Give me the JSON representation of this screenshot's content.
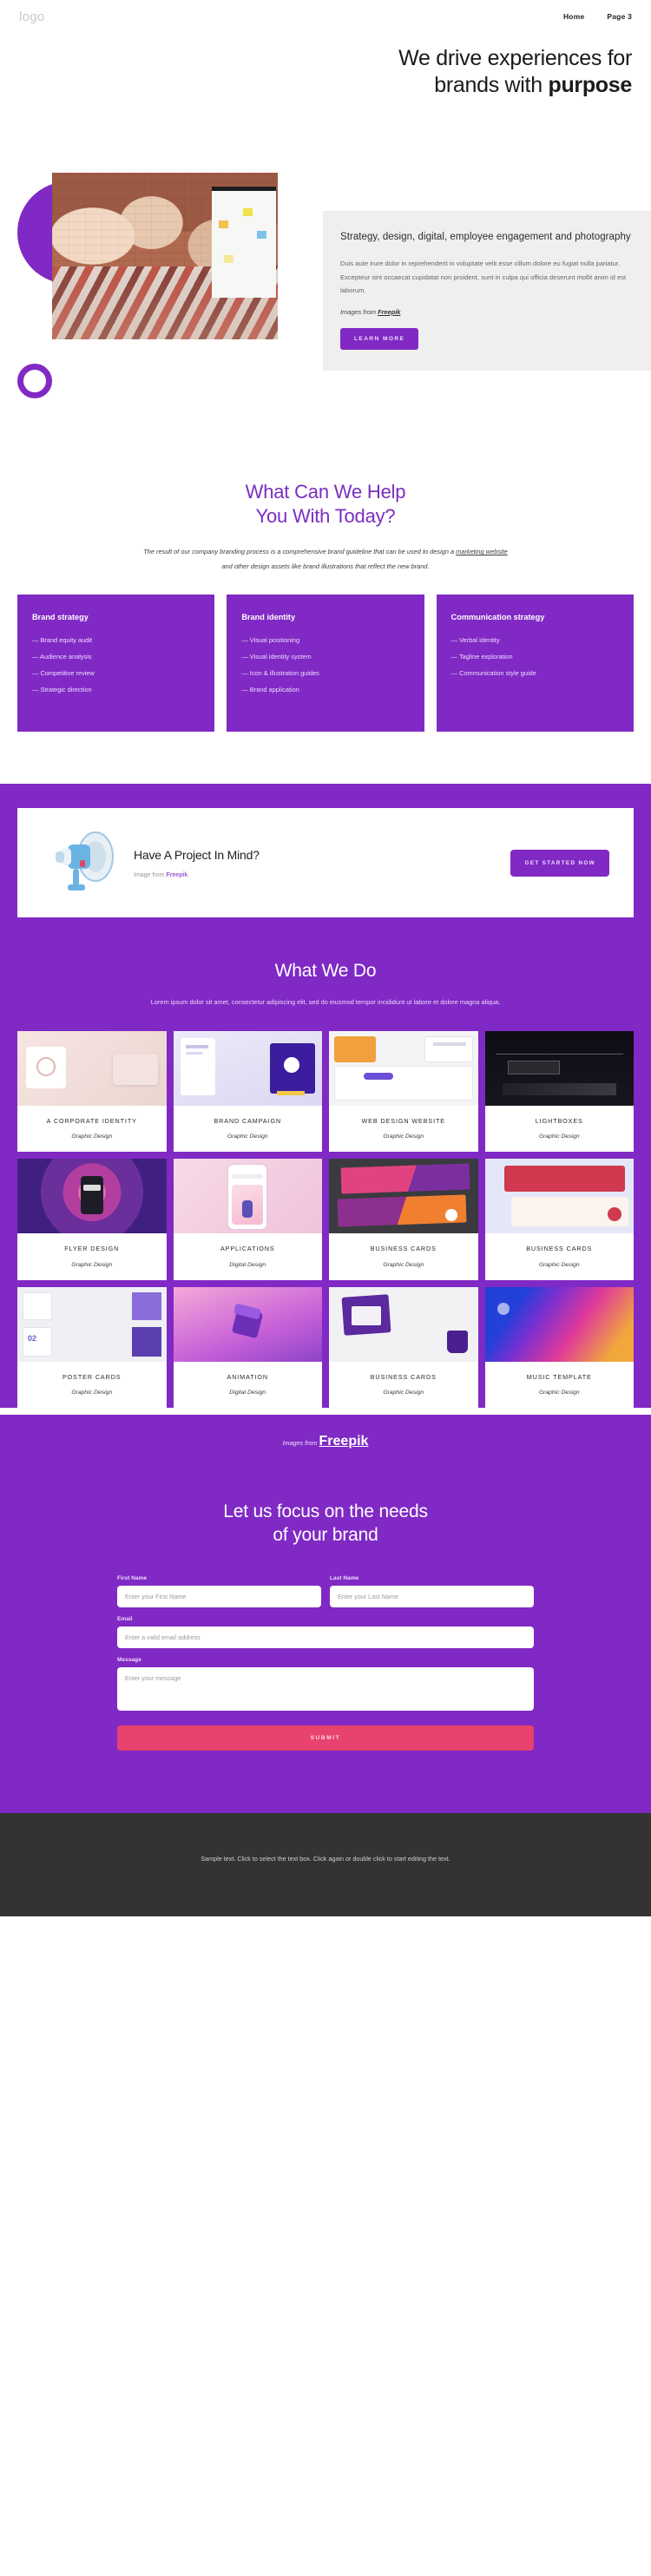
{
  "header": {
    "logo": "logo",
    "nav": [
      {
        "label": "Home"
      },
      {
        "label": "Page 3"
      }
    ]
  },
  "hero": {
    "title_line1": "We drive experiences for",
    "title_line2_plain": "brands with ",
    "title_line2_bold": "purpose",
    "card": {
      "heading": "Strategy, design, digital, employee engagement and photography",
      "body": "Duis aute irure dolor in reprehenderit in voluptate velit esse cillum dolore eu fugiat nulla pariatur. Excepteur sint occaecat cupidatat non proident, sunt in culpa qui officia deserunt mollit anim id est laborum.",
      "credit_prefix": "Images from ",
      "credit_link": "Freepik",
      "button": "LEARN MORE"
    }
  },
  "help": {
    "title_line1": "What Can We Help",
    "title_line2": "You With Today?",
    "desc_part1": "The result of our company branding process is a comprehensive brand guideline that can be used to design a ",
    "desc_link": "marketing website",
    "desc_part2": " and other design assets like brand illustrations that reflect the new brand.",
    "cards": [
      {
        "title": "Brand strategy",
        "items": [
          "— Brand equity audit",
          "— Audience analysis",
          "— Competitive review",
          "— Strategic direction"
        ]
      },
      {
        "title": "Brand identity",
        "items": [
          "— Visual positioning",
          "— Visual identity system",
          "— Icon & illustration guides",
          "— Brand application"
        ]
      },
      {
        "title": "Communication strategy",
        "items": [
          "— Verbal identity",
          "— Tagline exploration",
          "— Communication style guide"
        ]
      }
    ]
  },
  "cta": {
    "heading": "Have A Project In Mind?",
    "credit_prefix": "Image from ",
    "credit_link": "Freepik",
    "button": "GET STARTED NOW"
  },
  "work": {
    "title": "What We Do",
    "desc": "Lorem ipsum dolor sit amet, consectetur adipiscing elit, sed do eiusmod tempor incididunt ut labore et dolore magna aliqua.",
    "rows": [
      [
        {
          "title": "A CORPORATE IDENTITY",
          "sub": "Graphic Design"
        },
        {
          "title": "BRAND CAMPAIGN",
          "sub": "Graphic Design"
        },
        {
          "title": "WEB DESIGN WEBSITE",
          "sub": "Graphic Design"
        },
        {
          "title": "LIGHTBOXES",
          "sub": "Graphic Design"
        }
      ],
      [
        {
          "title": "FLYER DESIGN",
          "sub": "Graphic Design"
        },
        {
          "title": "APPLICATIONS",
          "sub": "Digital Design"
        },
        {
          "title": "BUSINESS CARDS",
          "sub": "Graphic Design"
        },
        {
          "title": "BUSINESS CARDS",
          "sub": "Graphic Design"
        }
      ],
      [
        {
          "title": "POSTER CARDS",
          "sub": "Graphic Design"
        },
        {
          "title": "ANIMATION",
          "sub": "Digital Design"
        },
        {
          "title": "BUSINESS CARDS",
          "sub": "Graphic Design"
        },
        {
          "title": "MUSIC TEMPLATE",
          "sub": "Graphic Design"
        }
      ]
    ],
    "credit_prefix": "Images from ",
    "credit_link": "Freepik"
  },
  "form": {
    "title_line1": "Let us focus on the needs",
    "title_line2": "of your brand",
    "first_name_label": "First Name",
    "first_name_placeholder": "Enter your First Name",
    "last_name_label": "Last Name",
    "last_name_placeholder": "Enter your Last Name",
    "email_label": "Email",
    "email_placeholder": "Enter a valid email address",
    "message_label": "Message",
    "message_placeholder": "Enter your message",
    "submit": "SUBMIT"
  },
  "footer": {
    "text": "Sample text. Click to select the text box. Click again or double click to start editing the text."
  },
  "colors": {
    "purple": "#8029c4",
    "heading_purple": "#7a2ec0",
    "pink": "#e8426e",
    "footer_dark": "#333333",
    "card_gray": "#efefef"
  }
}
